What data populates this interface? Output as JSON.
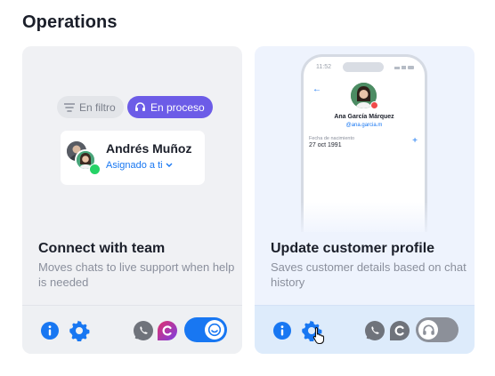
{
  "section": {
    "title": "Operations"
  },
  "cards": [
    {
      "title": "Connect with team",
      "description": "Moves chats to live support when help is needed",
      "illustration": {
        "chip_filter": "En filtro",
        "chip_process": "En proceso",
        "contact_name": "Andrés Muñoz",
        "assign_label": "Asignado a ti"
      },
      "channels": [
        "whatsapp-icon",
        "chat-c-icon"
      ],
      "toggle_on": true
    },
    {
      "title": "Update customer profile",
      "description": "Saves customer details based on chat history",
      "phone": {
        "time": "11:52",
        "name": "Ana García Márquez",
        "handle": "@ana.garcia.m",
        "field_label": "Fecha de nacimiento",
        "field_value": "27 oct 1991"
      },
      "channels": [
        "whatsapp-icon",
        "chat-c-icon"
      ],
      "toggle_on": false
    }
  ],
  "colors": {
    "accent": "#1877f2",
    "process_chip": "#6c5ce7",
    "toggle_off": "#8c9099"
  }
}
